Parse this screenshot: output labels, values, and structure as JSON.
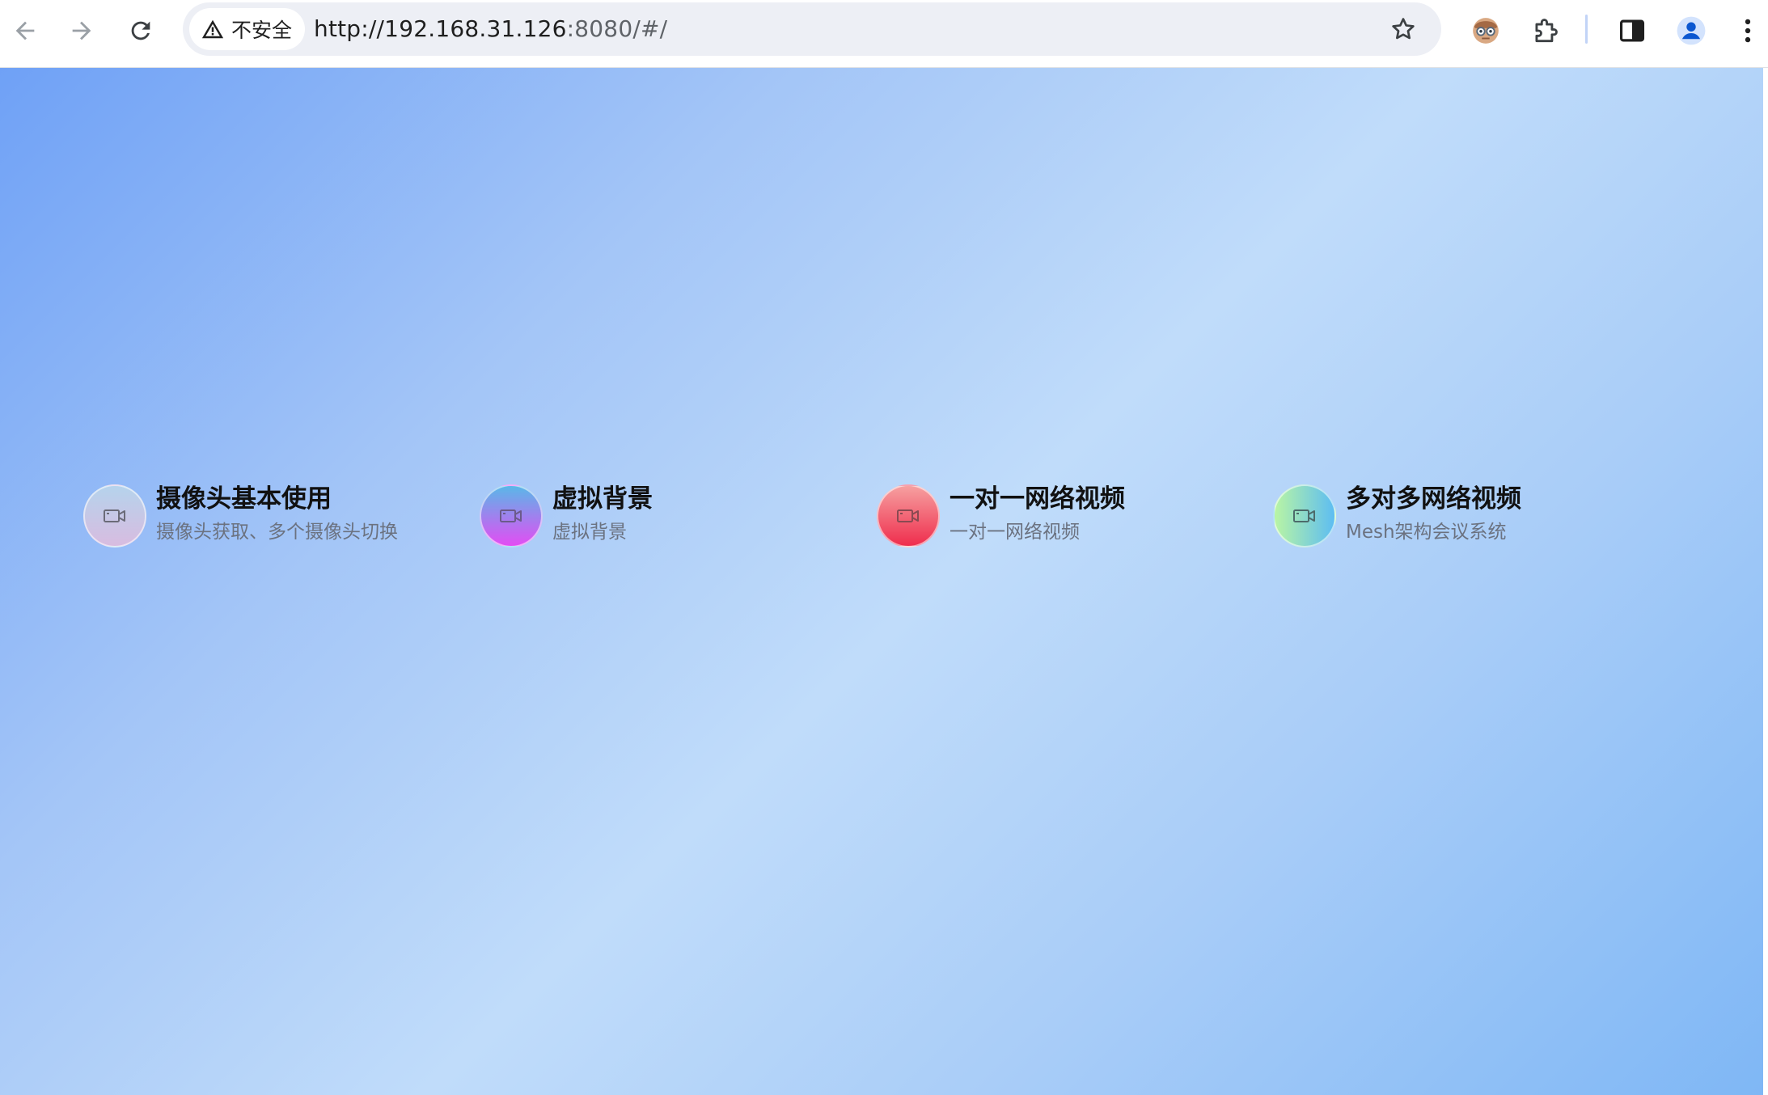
{
  "browser": {
    "security_label": "不安全",
    "url_host": "http://192.168.31.126",
    "url_rest": ":8080/#/"
  },
  "main": {
    "cards": [
      {
        "title": "摄像头基本使用",
        "subtitle": "摄像头获取、多个摄像头切换",
        "icon": "video-camera-icon",
        "gradient": [
          "#b5d3ec",
          "#d8bce0"
        ]
      },
      {
        "title": "虚拟背景",
        "subtitle": "虚拟背景",
        "icon": "video-camera-icon",
        "gradient": [
          "#5ab7e8",
          "#e34df3"
        ]
      },
      {
        "title": "一对一网络视频",
        "subtitle": "一对一网络视频",
        "icon": "video-camera-icon",
        "gradient": [
          "#f6a0a0",
          "#ef2d4d"
        ]
      },
      {
        "title": "多对多网络视频",
        "subtitle": "Mesh架构会议系统",
        "icon": "video-camera-icon",
        "gradient": [
          "#b9f5a4",
          "#5dbdf2"
        ]
      }
    ]
  },
  "colors": {
    "background_gradient": [
      "#6fa1f6",
      "#c0dcfa",
      "#7fb7f5"
    ]
  }
}
